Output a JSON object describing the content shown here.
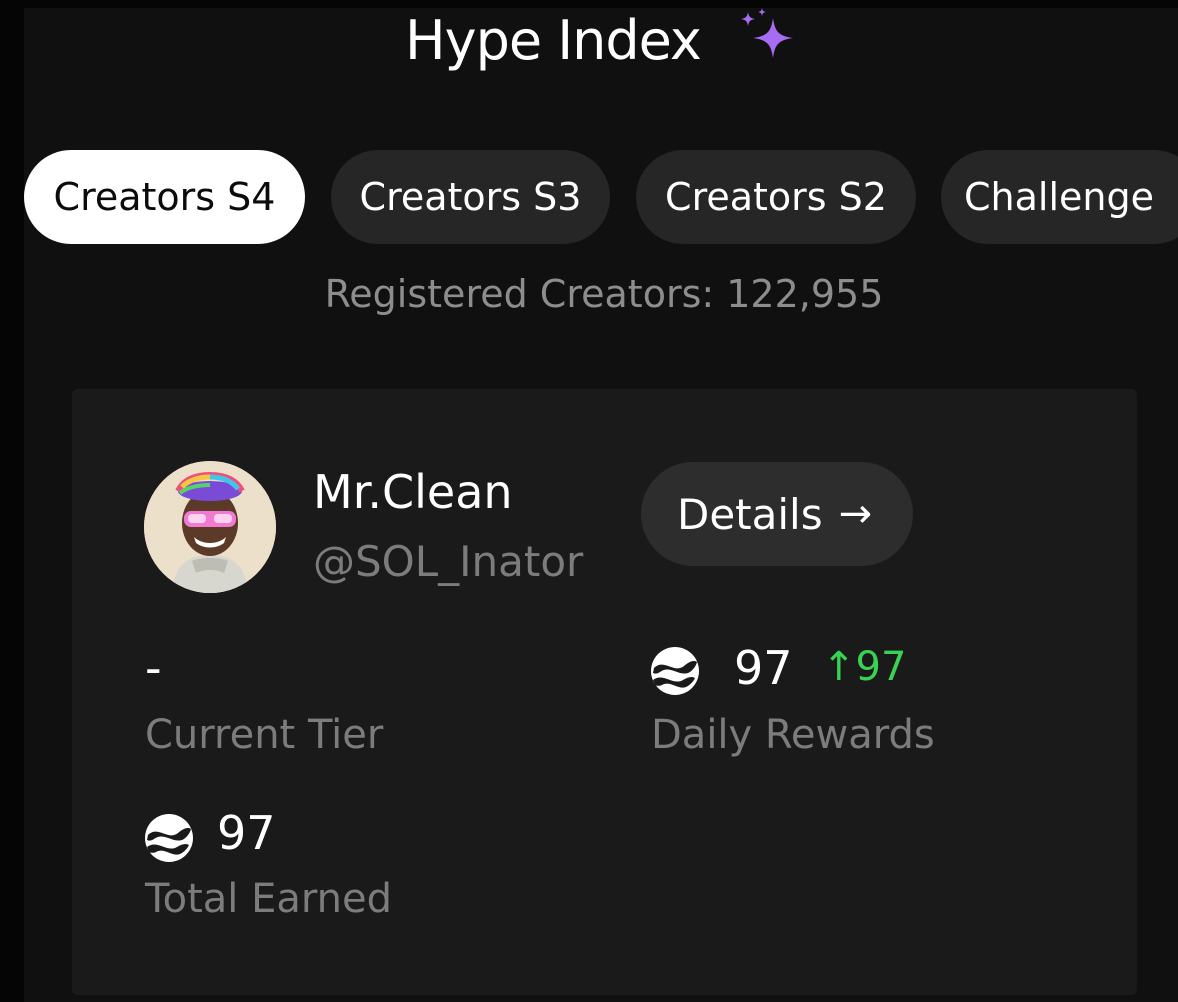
{
  "header": {
    "title": "Hype Index",
    "title_icon": "sparkle-icon",
    "accent_color": "#a66cf2"
  },
  "tabs": [
    {
      "label": "Creators S4",
      "active": true
    },
    {
      "label": "Creators S3",
      "active": false
    },
    {
      "label": "Creators S2",
      "active": false
    },
    {
      "label": "Challenge",
      "active": false
    }
  ],
  "registered_creators": "Registered Creators: 122,955",
  "profile": {
    "display_name": "Mr.Clean",
    "handle": "@SOL_Inator",
    "details_label": "Details",
    "details_arrow": "→"
  },
  "stats": {
    "current_tier": {
      "value": "-",
      "label": "Current Tier"
    },
    "daily_rewards": {
      "value": "97",
      "change": "↑97",
      "label": "Daily Rewards",
      "icon": "token-icon",
      "change_color": "#39d353"
    },
    "total_earned": {
      "value": "97",
      "label": "Total Earned",
      "icon": "token-icon"
    }
  }
}
